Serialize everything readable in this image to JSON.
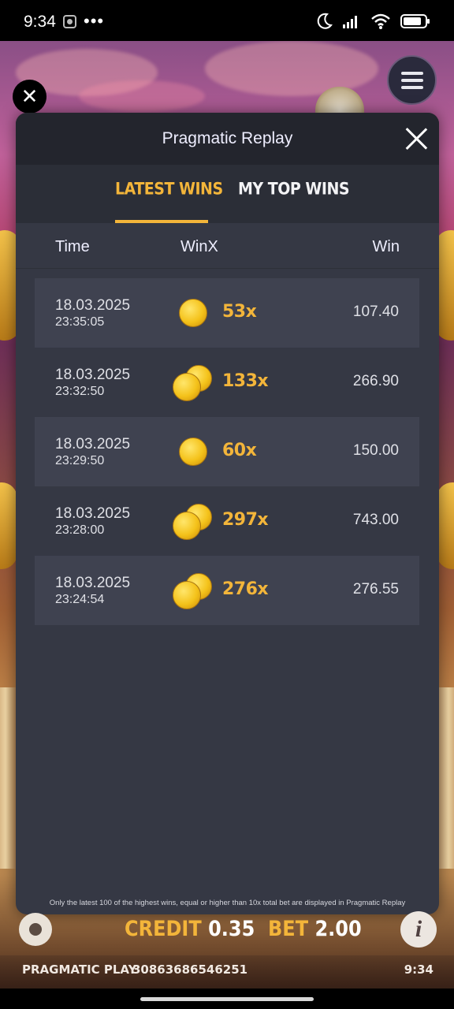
{
  "status_bar": {
    "time": "9:34",
    "more": "•••",
    "icons": [
      "notification-icon",
      "moon-icon",
      "signal-icon",
      "wifi-icon",
      "battery-icon"
    ]
  },
  "modal": {
    "title": "Pragmatic Replay",
    "tabs": [
      {
        "label": "LATEST WINS",
        "active": true
      },
      {
        "label": "MY TOP WINS",
        "active": false
      }
    ],
    "columns": {
      "time": "Time",
      "winx": "WinX",
      "win": "Win"
    },
    "rows": [
      {
        "date": "18.03.2025",
        "time": "23:35:05",
        "multiplier": "53x",
        "win": "107.40",
        "coins": 1
      },
      {
        "date": "18.03.2025",
        "time": "23:32:50",
        "multiplier": "133x",
        "win": "266.90",
        "coins": 2
      },
      {
        "date": "18.03.2025",
        "time": "23:29:50",
        "multiplier": "60x",
        "win": "150.00",
        "coins": 1
      },
      {
        "date": "18.03.2025",
        "time": "23:28:00",
        "multiplier": "297x",
        "win": "743.00",
        "coins": 2
      },
      {
        "date": "18.03.2025",
        "time": "23:24:54",
        "multiplier": "276x",
        "win": "276.55",
        "coins": 2
      }
    ],
    "footnote": "Only the latest 100 of the highest wins, equal or higher than 10x total bet are displayed in Pragmatic Replay"
  },
  "game_bar": {
    "credit_label": "CREDIT",
    "credit_value": "0.35",
    "bet_label": "BET",
    "bet_value": "2.00",
    "provider": "PRAGMATIC PLAY",
    "session_id": "30863686546251",
    "clock": "9:34"
  },
  "colors": {
    "accent": "#f3b53a",
    "modal_bg": "#353844",
    "header_bg": "#23252d"
  }
}
